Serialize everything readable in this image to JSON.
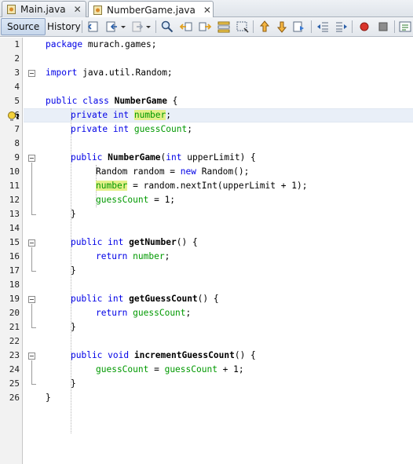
{
  "tabs": [
    {
      "label": "Main.java",
      "active": false
    },
    {
      "label": "NumberGame.java",
      "active": true
    }
  ],
  "toolbar": {
    "source_label": "Source",
    "history_label": "History"
  },
  "editor": {
    "line_numbers": [
      "1",
      "2",
      "3",
      "4",
      "5",
      "6",
      "7",
      "8",
      "9",
      "10",
      "11",
      "12",
      "13",
      "14",
      "15",
      "16",
      "17",
      "18",
      "19",
      "20",
      "21",
      "22",
      "23",
      "24",
      "25",
      "26"
    ],
    "code": {
      "l1_kw": "package",
      "l1_rest": " murach.games;",
      "l3_kw": "import",
      "l3_rest": " java.util.Random;",
      "l5_kw": "public class",
      "l5_name": "NumberGame",
      "l5_rest": " {",
      "l6_kw": "private int",
      "l6_fld": "number",
      "l6_rest": ";",
      "l7_kw": "private int",
      "l7_fld": "guessCount",
      "l7_rest": ";",
      "l9_kw1": "public",
      "l9_name": "NumberGame",
      "l9_p1": "(",
      "l9_kw2": "int",
      "l9_rest": " upperLimit) {",
      "l10_a": "Random random = ",
      "l10_kw": "new",
      "l10_b": " Random();",
      "l11_fld": "number",
      "l11_rest": " = random.nextInt(upperLimit + 1);",
      "l12_fld": "guessCount",
      "l12_rest": " = 1;",
      "l13": "}",
      "l15_kw": "public int",
      "l15_name": "getNumber",
      "l15_rest": "() {",
      "l16_kw": "return",
      "l16_fld": "number",
      "l16_rest": ";",
      "l17": "}",
      "l19_kw": "public int",
      "l19_name": "getGuessCount",
      "l19_rest": "() {",
      "l20_kw": "return",
      "l20_fld": "guessCount",
      "l20_rest": ";",
      "l21": "}",
      "l23_kw": "public void",
      "l23_name": "incrementGuessCount",
      "l23_rest": "() {",
      "l24_fld1": "guessCount",
      "l24_mid": " = ",
      "l24_fld2": "guessCount",
      "l24_rest": " + 1;",
      "l25": "}",
      "l26": "}"
    }
  },
  "colors": {
    "keyword": "#0000e6",
    "field": "#009900",
    "occurrence_highlight": "#e4f08a",
    "current_line": "#e9eff8"
  }
}
